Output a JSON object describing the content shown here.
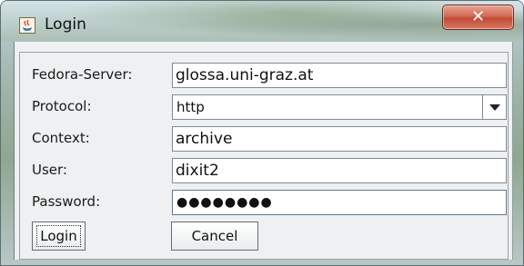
{
  "window": {
    "title": "Login",
    "close_label": "✕",
    "app_icon": "java-cup-icon"
  },
  "form": {
    "fields": [
      {
        "label": "Fedora-Server:",
        "value": "glossa.uni-graz.at"
      },
      {
        "label": "Protocol:",
        "value": "http"
      },
      {
        "label": "Context:",
        "value": "archive"
      },
      {
        "label": "User:",
        "value": "dixit2"
      },
      {
        "label": "Password:",
        "value": "●●●●●●●●"
      }
    ]
  },
  "buttons": {
    "login_label": "Login",
    "cancel_label": "Cancel"
  }
}
